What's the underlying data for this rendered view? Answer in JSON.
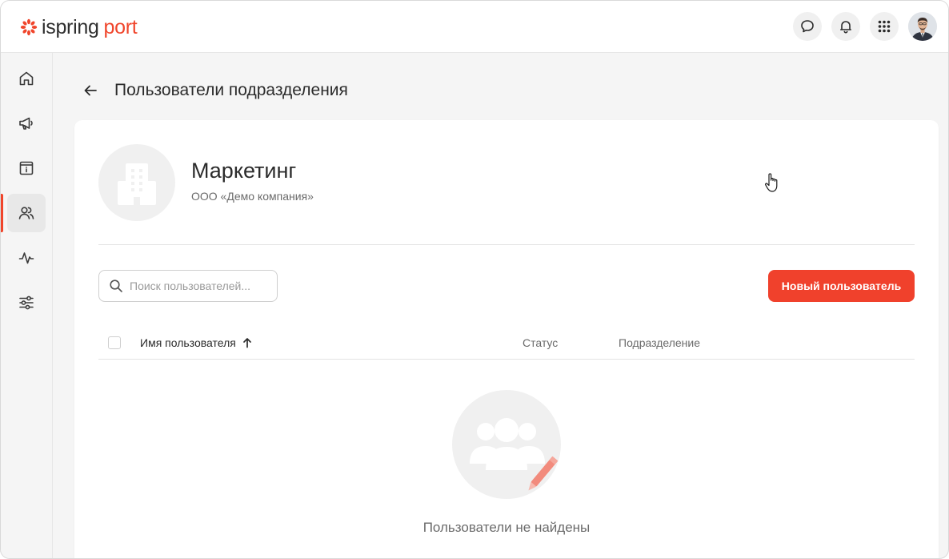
{
  "header": {
    "logo_part1": "ispring",
    "logo_part2": "port",
    "icons": [
      "chat-icon",
      "bell-icon",
      "apps-grid-icon",
      "user-avatar"
    ]
  },
  "sidebar": {
    "items": [
      {
        "name": "home",
        "icon": "home-icon",
        "active": false
      },
      {
        "name": "announcements",
        "icon": "megaphone-icon",
        "active": false
      },
      {
        "name": "catalog",
        "icon": "info-box-icon",
        "active": false
      },
      {
        "name": "users",
        "icon": "users-icon",
        "active": true
      },
      {
        "name": "activity",
        "icon": "pulse-icon",
        "active": false
      },
      {
        "name": "settings",
        "icon": "sliders-icon",
        "active": false
      }
    ]
  },
  "page": {
    "title": "Пользователи подразделения"
  },
  "department": {
    "name": "Маркетинг",
    "company": "ООО «Демо компания»"
  },
  "toolbar": {
    "search_placeholder": "Поиск пользователей...",
    "new_user_label": "Новый пользователь"
  },
  "table": {
    "columns": {
      "name": "Имя пользователя",
      "status": "Статус",
      "department": "Подразделение"
    },
    "sort": "ascending"
  },
  "empty_state": {
    "message": "Пользователи не найдены"
  },
  "colors": {
    "accent": "#f0412c",
    "text": "#2b2b2b",
    "muted": "#6b6b6b",
    "background": "#f5f5f5"
  }
}
